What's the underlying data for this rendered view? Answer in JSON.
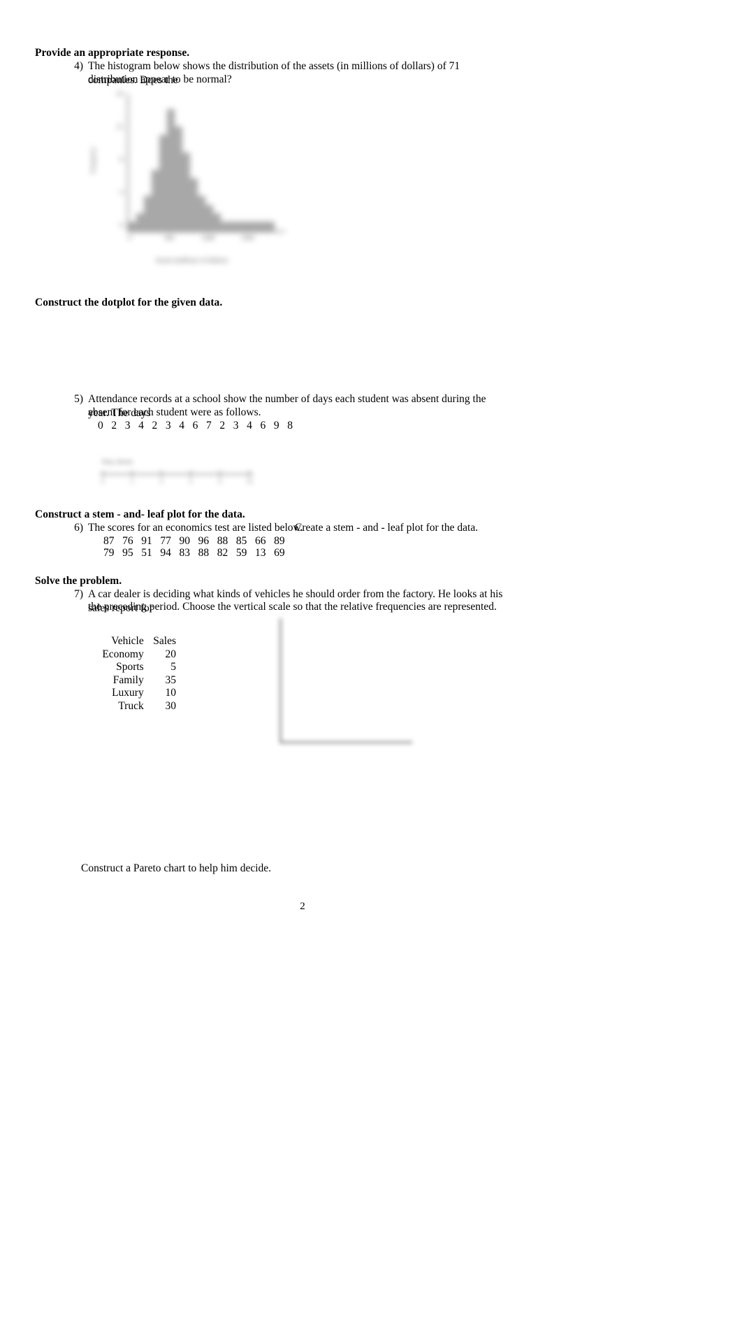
{
  "document": {
    "page_number": "2"
  },
  "sections": [
    {
      "id": "provide-response",
      "heading": "Provide an appropriate response."
    },
    {
      "id": "construct-dotplot",
      "heading": "Construct the dotplot for the given data."
    },
    {
      "id": "construct-stem-leaf",
      "heading": "Construct a stem - and- leaf plot for the data."
    },
    {
      "id": "solve-problem",
      "heading": "Solve the problem."
    }
  ],
  "questions": {
    "q4": {
      "number": "4)",
      "line1": "The histogram below shows the distribution of the assets (in millions of dollars) of 71 companies. Does the",
      "line2": "distribution appear to be normal?"
    },
    "q5": {
      "number": "5)",
      "line1": "Attendance records at a school show the number of days each student was absent during the year. The days",
      "line2": "absent for each student were as follows.",
      "data": "0   2   3   4   2   3   4   6   7   2   3   4   6   9   8"
    },
    "q6": {
      "number": "6)",
      "line1": "The scores for an economics test are listed below.",
      "line1b": "Create a stem   - and - leaf plot for the data.",
      "data_row1": "87   76   91   77   90   96   88   85   66   89",
      "data_row2": "79   95   51   94   83   88   82   59   13   69"
    },
    "q7": {
      "number": "7)",
      "line1": "A car dealer is deciding what kinds of vehicles he should order from the factory. He looks at his sales report for",
      "line2": "the preceding period. Choose the vertical scale so that the relative frequencies are represented.",
      "footer": "Construct a Pareto chart to help him decide."
    }
  },
  "vehicle_table": {
    "columns": [
      "Vehicle",
      "Sales"
    ],
    "rows": [
      {
        "vehicle": "Economy",
        "sales": "20"
      },
      {
        "vehicle": "Sports",
        "sales": "5"
      },
      {
        "vehicle": "Family",
        "sales": "35"
      },
      {
        "vehicle": "Luxury",
        "sales": "10"
      },
      {
        "vehicle": "Truck",
        "sales": "30"
      }
    ]
  },
  "chart_data": [
    {
      "id": "assets-histogram",
      "type": "bar",
      "title": "",
      "xlabel": "Assets (millions of dollars)",
      "ylabel": "Frequency",
      "categories": [
        "0",
        "100",
        "200",
        "300",
        "400",
        "500",
        "600",
        "700",
        "800",
        "900",
        "1000",
        "1100",
        "1200",
        "1300",
        "1400",
        "1500",
        "1600",
        "1700",
        "1800"
      ],
      "values": [
        1,
        2,
        4,
        7,
        11,
        14,
        12,
        9,
        6,
        4,
        3,
        2,
        1,
        1,
        1,
        1,
        1,
        1,
        1
      ],
      "xticks": [
        "0",
        "500",
        "1000",
        "1500"
      ],
      "yticks": [
        "0",
        "4",
        "8",
        "12",
        "16"
      ],
      "ylim": [
        0,
        16
      ],
      "grid": false,
      "legend": "none",
      "bar_color": "#a8a8a8",
      "note": "figure is rendered blurred in the source document"
    },
    {
      "id": "dotplot-blank-axis",
      "type": "scatter",
      "title": "Days absent",
      "xlabel": "",
      "ylabel": "",
      "x": [
        0,
        1,
        2,
        3,
        4,
        5,
        6,
        7,
        8,
        9,
        10
      ],
      "values": [],
      "xticks": [
        "0",
        "2",
        "4",
        "6",
        "8",
        "10"
      ],
      "grid": false,
      "legend": "none",
      "note": "blank number line provided for the student to fill in; rendered blurred"
    },
    {
      "id": "pareto-blank-axes",
      "type": "bar",
      "title": "",
      "xlabel": "",
      "ylabel": "",
      "categories": [],
      "values": [],
      "grid": false,
      "legend": "none",
      "note": "empty L-shaped axes provided for the student to draw the Pareto chart; rendered blurred"
    }
  ]
}
